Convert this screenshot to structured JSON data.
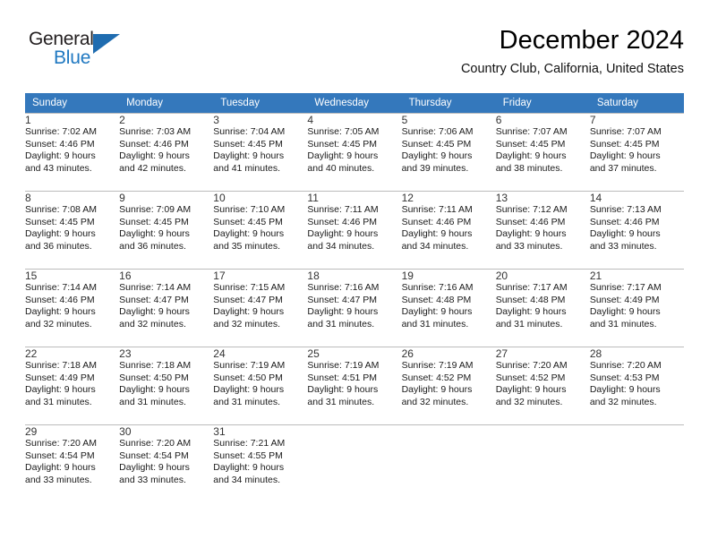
{
  "brand": {
    "name_top": "General",
    "name_bottom": "Blue",
    "triangle_color": "#1f6cb0",
    "blue_color": "#1f78c1"
  },
  "header": {
    "title": "December 2024",
    "subtitle": "Country Club, California, United States"
  },
  "theme": {
    "header_bg": "#3478bc",
    "header_text": "#ffffff",
    "daynum_bg": "#f0f0f0",
    "grid_line": "#bcbcbc"
  },
  "weekdays": [
    "Sunday",
    "Monday",
    "Tuesday",
    "Wednesday",
    "Thursday",
    "Friday",
    "Saturday"
  ],
  "labels": {
    "sunrise_prefix": "Sunrise:",
    "sunset_prefix": "Sunset:",
    "daylight_prefix": "Daylight:"
  },
  "weeks": [
    [
      {
        "day": "1",
        "l1": "Sunrise: 7:02 AM",
        "l2": "Sunset: 4:46 PM",
        "l3": "Daylight: 9 hours",
        "l4": "and 43 minutes."
      },
      {
        "day": "2",
        "l1": "Sunrise: 7:03 AM",
        "l2": "Sunset: 4:46 PM",
        "l3": "Daylight: 9 hours",
        "l4": "and 42 minutes."
      },
      {
        "day": "3",
        "l1": "Sunrise: 7:04 AM",
        "l2": "Sunset: 4:45 PM",
        "l3": "Daylight: 9 hours",
        "l4": "and 41 minutes."
      },
      {
        "day": "4",
        "l1": "Sunrise: 7:05 AM",
        "l2": "Sunset: 4:45 PM",
        "l3": "Daylight: 9 hours",
        "l4": "and 40 minutes."
      },
      {
        "day": "5",
        "l1": "Sunrise: 7:06 AM",
        "l2": "Sunset: 4:45 PM",
        "l3": "Daylight: 9 hours",
        "l4": "and 39 minutes."
      },
      {
        "day": "6",
        "l1": "Sunrise: 7:07 AM",
        "l2": "Sunset: 4:45 PM",
        "l3": "Daylight: 9 hours",
        "l4": "and 38 minutes."
      },
      {
        "day": "7",
        "l1": "Sunrise: 7:07 AM",
        "l2": "Sunset: 4:45 PM",
        "l3": "Daylight: 9 hours",
        "l4": "and 37 minutes."
      }
    ],
    [
      {
        "day": "8",
        "l1": "Sunrise: 7:08 AM",
        "l2": "Sunset: 4:45 PM",
        "l3": "Daylight: 9 hours",
        "l4": "and 36 minutes."
      },
      {
        "day": "9",
        "l1": "Sunrise: 7:09 AM",
        "l2": "Sunset: 4:45 PM",
        "l3": "Daylight: 9 hours",
        "l4": "and 36 minutes."
      },
      {
        "day": "10",
        "l1": "Sunrise: 7:10 AM",
        "l2": "Sunset: 4:45 PM",
        "l3": "Daylight: 9 hours",
        "l4": "and 35 minutes."
      },
      {
        "day": "11",
        "l1": "Sunrise: 7:11 AM",
        "l2": "Sunset: 4:46 PM",
        "l3": "Daylight: 9 hours",
        "l4": "and 34 minutes."
      },
      {
        "day": "12",
        "l1": "Sunrise: 7:11 AM",
        "l2": "Sunset: 4:46 PM",
        "l3": "Daylight: 9 hours",
        "l4": "and 34 minutes."
      },
      {
        "day": "13",
        "l1": "Sunrise: 7:12 AM",
        "l2": "Sunset: 4:46 PM",
        "l3": "Daylight: 9 hours",
        "l4": "and 33 minutes."
      },
      {
        "day": "14",
        "l1": "Sunrise: 7:13 AM",
        "l2": "Sunset: 4:46 PM",
        "l3": "Daylight: 9 hours",
        "l4": "and 33 minutes."
      }
    ],
    [
      {
        "day": "15",
        "l1": "Sunrise: 7:14 AM",
        "l2": "Sunset: 4:46 PM",
        "l3": "Daylight: 9 hours",
        "l4": "and 32 minutes."
      },
      {
        "day": "16",
        "l1": "Sunrise: 7:14 AM",
        "l2": "Sunset: 4:47 PM",
        "l3": "Daylight: 9 hours",
        "l4": "and 32 minutes."
      },
      {
        "day": "17",
        "l1": "Sunrise: 7:15 AM",
        "l2": "Sunset: 4:47 PM",
        "l3": "Daylight: 9 hours",
        "l4": "and 32 minutes."
      },
      {
        "day": "18",
        "l1": "Sunrise: 7:16 AM",
        "l2": "Sunset: 4:47 PM",
        "l3": "Daylight: 9 hours",
        "l4": "and 31 minutes."
      },
      {
        "day": "19",
        "l1": "Sunrise: 7:16 AM",
        "l2": "Sunset: 4:48 PM",
        "l3": "Daylight: 9 hours",
        "l4": "and 31 minutes."
      },
      {
        "day": "20",
        "l1": "Sunrise: 7:17 AM",
        "l2": "Sunset: 4:48 PM",
        "l3": "Daylight: 9 hours",
        "l4": "and 31 minutes."
      },
      {
        "day": "21",
        "l1": "Sunrise: 7:17 AM",
        "l2": "Sunset: 4:49 PM",
        "l3": "Daylight: 9 hours",
        "l4": "and 31 minutes."
      }
    ],
    [
      {
        "day": "22",
        "l1": "Sunrise: 7:18 AM",
        "l2": "Sunset: 4:49 PM",
        "l3": "Daylight: 9 hours",
        "l4": "and 31 minutes."
      },
      {
        "day": "23",
        "l1": "Sunrise: 7:18 AM",
        "l2": "Sunset: 4:50 PM",
        "l3": "Daylight: 9 hours",
        "l4": "and 31 minutes."
      },
      {
        "day": "24",
        "l1": "Sunrise: 7:19 AM",
        "l2": "Sunset: 4:50 PM",
        "l3": "Daylight: 9 hours",
        "l4": "and 31 minutes."
      },
      {
        "day": "25",
        "l1": "Sunrise: 7:19 AM",
        "l2": "Sunset: 4:51 PM",
        "l3": "Daylight: 9 hours",
        "l4": "and 31 minutes."
      },
      {
        "day": "26",
        "l1": "Sunrise: 7:19 AM",
        "l2": "Sunset: 4:52 PM",
        "l3": "Daylight: 9 hours",
        "l4": "and 32 minutes."
      },
      {
        "day": "27",
        "l1": "Sunrise: 7:20 AM",
        "l2": "Sunset: 4:52 PM",
        "l3": "Daylight: 9 hours",
        "l4": "and 32 minutes."
      },
      {
        "day": "28",
        "l1": "Sunrise: 7:20 AM",
        "l2": "Sunset: 4:53 PM",
        "l3": "Daylight: 9 hours",
        "l4": "and 32 minutes."
      }
    ],
    [
      {
        "day": "29",
        "l1": "Sunrise: 7:20 AM",
        "l2": "Sunset: 4:54 PM",
        "l3": "Daylight: 9 hours",
        "l4": "and 33 minutes."
      },
      {
        "day": "30",
        "l1": "Sunrise: 7:20 AM",
        "l2": "Sunset: 4:54 PM",
        "l3": "Daylight: 9 hours",
        "l4": "and 33 minutes."
      },
      {
        "day": "31",
        "l1": "Sunrise: 7:21 AM",
        "l2": "Sunset: 4:55 PM",
        "l3": "Daylight: 9 hours",
        "l4": "and 34 minutes."
      },
      {
        "day": "",
        "l1": "",
        "l2": "",
        "l3": "",
        "l4": ""
      },
      {
        "day": "",
        "l1": "",
        "l2": "",
        "l3": "",
        "l4": ""
      },
      {
        "day": "",
        "l1": "",
        "l2": "",
        "l3": "",
        "l4": ""
      },
      {
        "day": "",
        "l1": "",
        "l2": "",
        "l3": "",
        "l4": ""
      }
    ]
  ]
}
